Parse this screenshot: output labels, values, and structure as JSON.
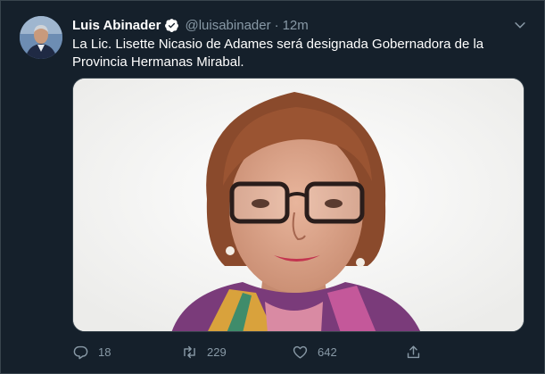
{
  "tweet": {
    "author_name": "Luis Abinader",
    "handle": "@luisabinader",
    "separator": "·",
    "time": "12m",
    "text": "La Lic. Lisette Nicasio de Adames será designada Gobernadora de la Provincia Hermanas Mirabal.",
    "verified": true
  },
  "actions": {
    "reply_count": "18",
    "retweet_count": "229",
    "like_count": "642"
  },
  "icons": {
    "reply": "reply-icon",
    "retweet": "retweet-icon",
    "like": "heart-icon",
    "share": "share-icon",
    "menu": "chevron-down-icon",
    "verified": "verified-badge-icon"
  },
  "colors": {
    "background": "#15202b",
    "secondary_text": "#8899a6",
    "accent": "#1da1f2",
    "border": "#38444d"
  }
}
